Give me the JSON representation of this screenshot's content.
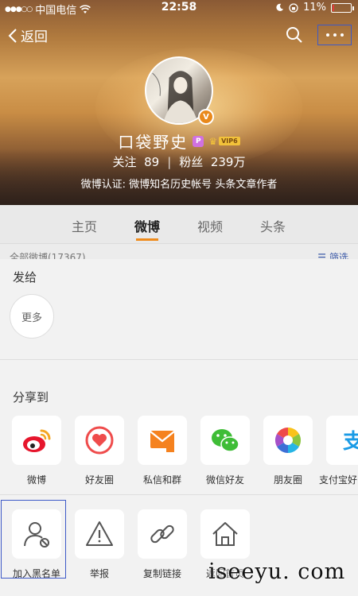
{
  "status_bar": {
    "signal_dots": "●●●○○",
    "carrier": "中国电信",
    "time": "22:58",
    "battery": "11%",
    "battery_level": 0.11
  },
  "nav": {
    "back_label": "返回"
  },
  "profile": {
    "name": "口袋野史",
    "v_badge": "V",
    "p_badge": "P",
    "vip_label": "VIP6",
    "following_label": "关注",
    "following_count": "89",
    "followers_label": "粉丝",
    "followers_count": "239万",
    "verification": "微博认证: 微博知名历史帐号 头条文章作者"
  },
  "tabs": [
    {
      "label": "主页",
      "active": false
    },
    {
      "label": "微博",
      "active": true
    },
    {
      "label": "视频",
      "active": false
    },
    {
      "label": "头条",
      "active": false
    }
  ],
  "feed": {
    "count_label": "全部微博(17367)",
    "filter_label": "筛选"
  },
  "share_sheet": {
    "send_title": "发给",
    "more_label": "更多",
    "share_title": "分享到",
    "share_items": [
      {
        "label": "微博",
        "icon": "weibo-icon"
      },
      {
        "label": "好友圈",
        "icon": "friends-circle-icon"
      },
      {
        "label": "私信和群",
        "icon": "message-icon"
      },
      {
        "label": "微信好友",
        "icon": "wechat-icon"
      },
      {
        "label": "朋友圈",
        "icon": "moments-icon"
      },
      {
        "label": "支付宝好",
        "icon": "alipay-icon"
      }
    ],
    "action_items": [
      {
        "label": "加入黑名单",
        "icon": "block-user-icon"
      },
      {
        "label": "举报",
        "icon": "report-icon"
      },
      {
        "label": "复制链接",
        "icon": "link-icon"
      },
      {
        "label": "返回首页",
        "icon": "home-icon"
      }
    ]
  },
  "watermark": "iseeyu. com",
  "colors": {
    "accent_orange": "#ef8b1b",
    "highlight_blue": "#3d59c7",
    "weibo_red": "#e6162d",
    "wechat_green": "#3fbd37"
  }
}
